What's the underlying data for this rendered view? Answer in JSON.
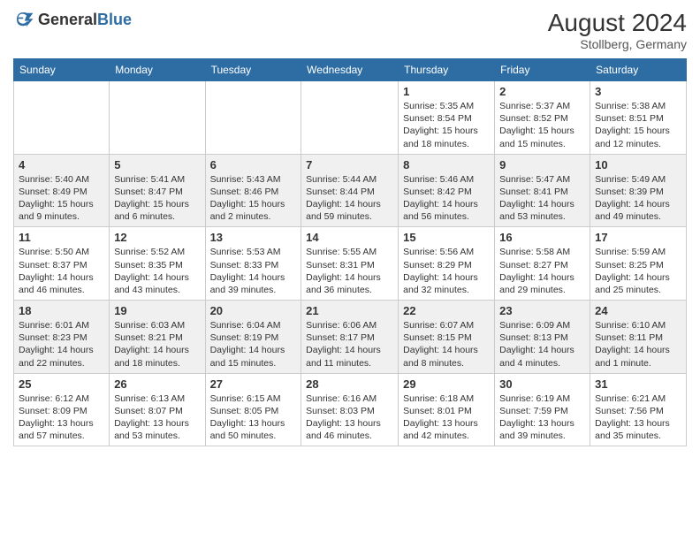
{
  "header": {
    "logo_general": "General",
    "logo_blue": "Blue",
    "month_year": "August 2024",
    "location": "Stollberg, Germany"
  },
  "weekdays": [
    "Sunday",
    "Monday",
    "Tuesday",
    "Wednesday",
    "Thursday",
    "Friday",
    "Saturday"
  ],
  "weeks": [
    [
      {
        "day": "",
        "sunrise": "",
        "sunset": "",
        "daylight": ""
      },
      {
        "day": "",
        "sunrise": "",
        "sunset": "",
        "daylight": ""
      },
      {
        "day": "",
        "sunrise": "",
        "sunset": "",
        "daylight": ""
      },
      {
        "day": "",
        "sunrise": "",
        "sunset": "",
        "daylight": ""
      },
      {
        "day": "1",
        "sunrise": "Sunrise: 5:35 AM",
        "sunset": "Sunset: 8:54 PM",
        "daylight": "Daylight: 15 hours and 18 minutes."
      },
      {
        "day": "2",
        "sunrise": "Sunrise: 5:37 AM",
        "sunset": "Sunset: 8:52 PM",
        "daylight": "Daylight: 15 hours and 15 minutes."
      },
      {
        "day": "3",
        "sunrise": "Sunrise: 5:38 AM",
        "sunset": "Sunset: 8:51 PM",
        "daylight": "Daylight: 15 hours and 12 minutes."
      }
    ],
    [
      {
        "day": "4",
        "sunrise": "Sunrise: 5:40 AM",
        "sunset": "Sunset: 8:49 PM",
        "daylight": "Daylight: 15 hours and 9 minutes."
      },
      {
        "day": "5",
        "sunrise": "Sunrise: 5:41 AM",
        "sunset": "Sunset: 8:47 PM",
        "daylight": "Daylight: 15 hours and 6 minutes."
      },
      {
        "day": "6",
        "sunrise": "Sunrise: 5:43 AM",
        "sunset": "Sunset: 8:46 PM",
        "daylight": "Daylight: 15 hours and 2 minutes."
      },
      {
        "day": "7",
        "sunrise": "Sunrise: 5:44 AM",
        "sunset": "Sunset: 8:44 PM",
        "daylight": "Daylight: 14 hours and 59 minutes."
      },
      {
        "day": "8",
        "sunrise": "Sunrise: 5:46 AM",
        "sunset": "Sunset: 8:42 PM",
        "daylight": "Daylight: 14 hours and 56 minutes."
      },
      {
        "day": "9",
        "sunrise": "Sunrise: 5:47 AM",
        "sunset": "Sunset: 8:41 PM",
        "daylight": "Daylight: 14 hours and 53 minutes."
      },
      {
        "day": "10",
        "sunrise": "Sunrise: 5:49 AM",
        "sunset": "Sunset: 8:39 PM",
        "daylight": "Daylight: 14 hours and 49 minutes."
      }
    ],
    [
      {
        "day": "11",
        "sunrise": "Sunrise: 5:50 AM",
        "sunset": "Sunset: 8:37 PM",
        "daylight": "Daylight: 14 hours and 46 minutes."
      },
      {
        "day": "12",
        "sunrise": "Sunrise: 5:52 AM",
        "sunset": "Sunset: 8:35 PM",
        "daylight": "Daylight: 14 hours and 43 minutes."
      },
      {
        "day": "13",
        "sunrise": "Sunrise: 5:53 AM",
        "sunset": "Sunset: 8:33 PM",
        "daylight": "Daylight: 14 hours and 39 minutes."
      },
      {
        "day": "14",
        "sunrise": "Sunrise: 5:55 AM",
        "sunset": "Sunset: 8:31 PM",
        "daylight": "Daylight: 14 hours and 36 minutes."
      },
      {
        "day": "15",
        "sunrise": "Sunrise: 5:56 AM",
        "sunset": "Sunset: 8:29 PM",
        "daylight": "Daylight: 14 hours and 32 minutes."
      },
      {
        "day": "16",
        "sunrise": "Sunrise: 5:58 AM",
        "sunset": "Sunset: 8:27 PM",
        "daylight": "Daylight: 14 hours and 29 minutes."
      },
      {
        "day": "17",
        "sunrise": "Sunrise: 5:59 AM",
        "sunset": "Sunset: 8:25 PM",
        "daylight": "Daylight: 14 hours and 25 minutes."
      }
    ],
    [
      {
        "day": "18",
        "sunrise": "Sunrise: 6:01 AM",
        "sunset": "Sunset: 8:23 PM",
        "daylight": "Daylight: 14 hours and 22 minutes."
      },
      {
        "day": "19",
        "sunrise": "Sunrise: 6:03 AM",
        "sunset": "Sunset: 8:21 PM",
        "daylight": "Daylight: 14 hours and 18 minutes."
      },
      {
        "day": "20",
        "sunrise": "Sunrise: 6:04 AM",
        "sunset": "Sunset: 8:19 PM",
        "daylight": "Daylight: 14 hours and 15 minutes."
      },
      {
        "day": "21",
        "sunrise": "Sunrise: 6:06 AM",
        "sunset": "Sunset: 8:17 PM",
        "daylight": "Daylight: 14 hours and 11 minutes."
      },
      {
        "day": "22",
        "sunrise": "Sunrise: 6:07 AM",
        "sunset": "Sunset: 8:15 PM",
        "daylight": "Daylight: 14 hours and 8 minutes."
      },
      {
        "day": "23",
        "sunrise": "Sunrise: 6:09 AM",
        "sunset": "Sunset: 8:13 PM",
        "daylight": "Daylight: 14 hours and 4 minutes."
      },
      {
        "day": "24",
        "sunrise": "Sunrise: 6:10 AM",
        "sunset": "Sunset: 8:11 PM",
        "daylight": "Daylight: 14 hours and 1 minute."
      }
    ],
    [
      {
        "day": "25",
        "sunrise": "Sunrise: 6:12 AM",
        "sunset": "Sunset: 8:09 PM",
        "daylight": "Daylight: 13 hours and 57 minutes."
      },
      {
        "day": "26",
        "sunrise": "Sunrise: 6:13 AM",
        "sunset": "Sunset: 8:07 PM",
        "daylight": "Daylight: 13 hours and 53 minutes."
      },
      {
        "day": "27",
        "sunrise": "Sunrise: 6:15 AM",
        "sunset": "Sunset: 8:05 PM",
        "daylight": "Daylight: 13 hours and 50 minutes."
      },
      {
        "day": "28",
        "sunrise": "Sunrise: 6:16 AM",
        "sunset": "Sunset: 8:03 PM",
        "daylight": "Daylight: 13 hours and 46 minutes."
      },
      {
        "day": "29",
        "sunrise": "Sunrise: 6:18 AM",
        "sunset": "Sunset: 8:01 PM",
        "daylight": "Daylight: 13 hours and 42 minutes."
      },
      {
        "day": "30",
        "sunrise": "Sunrise: 6:19 AM",
        "sunset": "Sunset: 7:59 PM",
        "daylight": "Daylight: 13 hours and 39 minutes."
      },
      {
        "day": "31",
        "sunrise": "Sunrise: 6:21 AM",
        "sunset": "Sunset: 7:56 PM",
        "daylight": "Daylight: 13 hours and 35 minutes."
      }
    ]
  ]
}
